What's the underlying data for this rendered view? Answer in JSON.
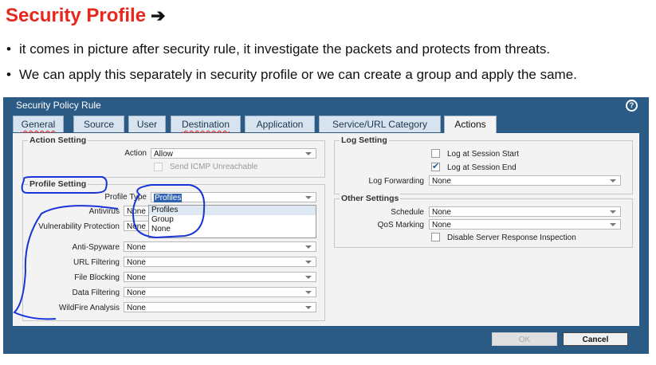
{
  "slide": {
    "title": "Security Profile",
    "arrow": "➔",
    "bullets": [
      "it comes in picture after security rule, it investigate the packets and protects from threats.",
      "We can apply this separately in security profile or we can create a group and apply the same."
    ]
  },
  "dialog": {
    "title": "Security Policy Rule",
    "help_icon": "?",
    "tabs": [
      "General",
      "Source",
      "User",
      "Destination",
      "Application",
      "Service/URL Category",
      "Actions"
    ],
    "active_tab": "Actions",
    "action_setting": {
      "label": "Action Setting",
      "action_label": "Action",
      "action_value": "Allow",
      "icmp_label": "Send ICMP Unreachable"
    },
    "profile_setting": {
      "label": "Profile Setting",
      "profile_type_label": "Profile Type",
      "profile_type_value": "Profiles",
      "dropdown_options": [
        "Profiles",
        "Group",
        "None"
      ],
      "rows": [
        {
          "label": "Antivirus",
          "value": "None"
        },
        {
          "label": "Vulnerability Protection",
          "value": "None"
        },
        {
          "label": "Anti-Spyware",
          "value": "None"
        },
        {
          "label": "URL Filtering",
          "value": "None"
        },
        {
          "label": "File Blocking",
          "value": "None"
        },
        {
          "label": "Data Filtering",
          "value": "None"
        },
        {
          "label": "WildFire Analysis",
          "value": "None"
        }
      ]
    },
    "log_setting": {
      "label": "Log Setting",
      "session_start_label": "Log at Session Start",
      "session_start_checked": false,
      "session_end_label": "Log at Session End",
      "session_end_checked": true,
      "forwarding_label": "Log Forwarding",
      "forwarding_value": "None"
    },
    "other_settings": {
      "label": "Other Settings",
      "schedule_label": "Schedule",
      "schedule_value": "None",
      "qos_label": "QoS Marking",
      "qos_value": "None",
      "disable_label": "Disable Server Response Inspection"
    },
    "buttons": {
      "ok": "OK",
      "cancel": "Cancel"
    }
  },
  "colors": {
    "title_red": "#e8261c",
    "dialog_blue": "#2b5b84",
    "ink_blue": "#1a35d6"
  }
}
